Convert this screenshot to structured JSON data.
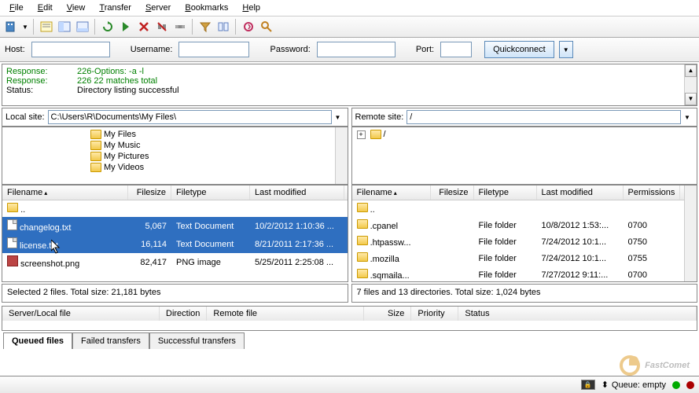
{
  "menu": {
    "file": "File",
    "edit": "Edit",
    "view": "View",
    "transfer": "Transfer",
    "server": "Server",
    "bookmarks": "Bookmarks",
    "help": "Help"
  },
  "conn": {
    "host_label": "Host:",
    "host": "",
    "user_label": "Username:",
    "user": "",
    "pass_label": "Password:",
    "pass": "",
    "port_label": "Port:",
    "port": "",
    "quickconnect": "Quickconnect"
  },
  "log": {
    "r1_label": "Response:",
    "r1_msg": "226-Options: -a -l",
    "r2_label": "Response:",
    "r2_msg": "226 22 matches total",
    "r3_label": "Status:",
    "r3_msg": "Directory listing successful"
  },
  "sites": {
    "local_label": "Local site:",
    "local_path": "C:\\Users\\R\\Documents\\My Files\\",
    "remote_label": "Remote site:",
    "remote_path": "/"
  },
  "local_tree": {
    "n1": "My Files",
    "n2": "My Music",
    "n3": "My Pictures",
    "n4": "My Videos"
  },
  "remote_tree": {
    "n1": "/"
  },
  "local_cols": {
    "name": "Filename",
    "size": "Filesize",
    "type": "Filetype",
    "mod": "Last modified"
  },
  "remote_cols": {
    "name": "Filename",
    "size": "Filesize",
    "type": "Filetype",
    "mod": "Last modified",
    "perm": "Permissions"
  },
  "local_rows": {
    "up": "..",
    "r1_name": "changelog.txt",
    "r1_size": "5,067",
    "r1_type": "Text Document",
    "r1_mod": "10/2/2012 1:10:36 ...",
    "r2_name": "license.txt",
    "r2_size": "16,114",
    "r2_type": "Text Document",
    "r2_mod": "8/21/2011 2:17:36 ...",
    "r3_name": "screenshot.png",
    "r3_size": "82,417",
    "r3_type": "PNG image",
    "r3_mod": "5/25/2011 2:25:08 ..."
  },
  "remote_rows": {
    "up": "..",
    "r1_name": ".cpanel",
    "r1_type": "File folder",
    "r1_mod": "10/8/2012 1:53:...",
    "r1_perm": "0700",
    "r2_name": ".htpassw...",
    "r2_type": "File folder",
    "r2_mod": "7/24/2012 10:1...",
    "r2_perm": "0750",
    "r3_name": ".mozilla",
    "r3_type": "File folder",
    "r3_mod": "7/24/2012 10:1...",
    "r3_perm": "0755",
    "r4_name": ".sqmaila...",
    "r4_type": "File folder",
    "r4_mod": "7/27/2012 9:11:...",
    "r4_perm": "0700"
  },
  "status": {
    "local": "Selected 2 files. Total size: 21,181 bytes",
    "remote": "7 files and 13 directories. Total size: 1,024 bytes"
  },
  "queue": {
    "sf": "Server/Local file",
    "dir": "Direction",
    "rf": "Remote file",
    "sz": "Size",
    "pr": "Priority",
    "st": "Status"
  },
  "tabs": {
    "t1": "Queued files",
    "t2": "Failed transfers",
    "t3": "Successful transfers"
  },
  "bottom": {
    "queue": "Queue: empty",
    "watermark": "FastComet"
  }
}
